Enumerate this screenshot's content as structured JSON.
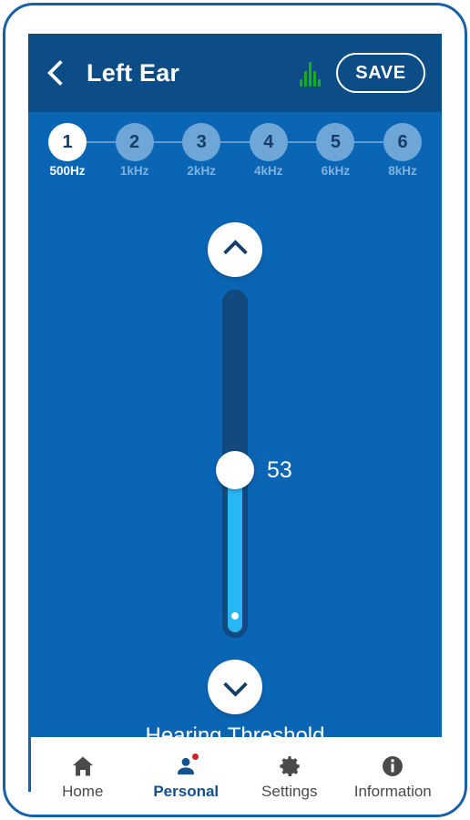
{
  "header": {
    "back_icon": "chevron-left-icon",
    "title": "Left Ear",
    "wave_icon": "audio-waveform-icon",
    "save_label": "SAVE",
    "background_color": "#0d4d87"
  },
  "theme": {
    "body_background": "#0b65b5",
    "accent_cyan": "#29b6f6",
    "track_navy": "#124a7f",
    "frame_border": "#1860a8",
    "active_nav_color": "#14508f",
    "badge_color": "#d12026",
    "wave_green": "#17b017"
  },
  "steps": {
    "items": [
      {
        "number": "1",
        "frequency": "500Hz",
        "active": true
      },
      {
        "number": "2",
        "frequency": "1kHz",
        "active": false
      },
      {
        "number": "3",
        "frequency": "2kHz",
        "active": false
      },
      {
        "number": "4",
        "frequency": "4kHz",
        "active": false
      },
      {
        "number": "5",
        "frequency": "6kHz",
        "active": false
      },
      {
        "number": "6",
        "frequency": "8kHz",
        "active": false
      }
    ]
  },
  "slider": {
    "increase_icon": "chevron-up-icon",
    "decrease_icon": "chevron-down-icon",
    "value": "53",
    "label": "Hearing Threshold"
  },
  "bottom_nav": {
    "items": [
      {
        "label": "Home",
        "icon": "home-icon",
        "active": false,
        "badge": false
      },
      {
        "label": "Personal",
        "icon": "person-icon",
        "active": true,
        "badge": true
      },
      {
        "label": "Settings",
        "icon": "gear-icon",
        "active": false,
        "badge": false
      },
      {
        "label": "Information",
        "icon": "info-icon",
        "active": false,
        "badge": false
      }
    ]
  }
}
